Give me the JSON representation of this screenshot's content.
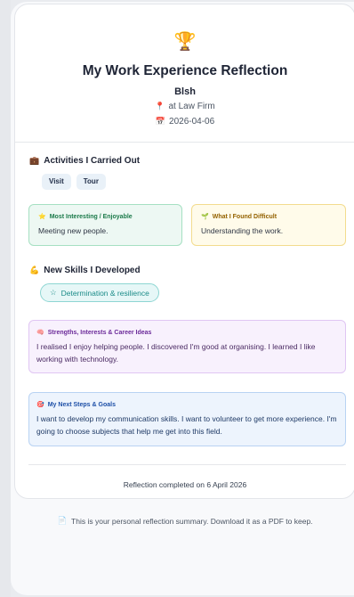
{
  "header": {
    "trophy_icon": "trophy-icon",
    "title": "My Work Experience Reflection",
    "student_name": "Blsh",
    "placement": "at Law Firm",
    "date": "2026-04-06",
    "pin_icon": "pin-icon",
    "calendar_icon": "calendar-icon"
  },
  "activities": {
    "title": "Activities I Carried Out",
    "icon": "briefcase-icon",
    "tags": [
      "Visit",
      "Tour"
    ]
  },
  "interesting": {
    "title": "Most Interesting / Enjoyable",
    "icon": "star-icon",
    "text": "Meeting new people."
  },
  "difficult": {
    "title": "What I Found Difficult",
    "icon": "seedling-icon",
    "text": "Understanding the work."
  },
  "skills": {
    "title": "New Skills I Developed",
    "icon": "flexed-arm-icon",
    "items": [
      "Determination & resilience"
    ]
  },
  "strengths": {
    "title": "Strengths, Interests & Career Ideas",
    "icon": "brain-icon",
    "text": "I realised I enjoy helping people. I discovered I'm good at organising. I learned I like working with technology."
  },
  "next_steps": {
    "title": "My Next Steps & Goals",
    "icon": "target-icon",
    "text": "I want to develop my communication skills. I want to volunteer to get more experience. I'm going to choose subjects that help me get into this field."
  },
  "footer": {
    "completed": "Reflection completed on 6 April 2026",
    "note": "This is your personal reflection summary. Download it as a PDF to keep.",
    "note_icon": "document-icon"
  },
  "colors": {
    "green_accent": "#1b7a4a",
    "yellow_accent": "#946200",
    "teal_accent": "#1b8b88",
    "purple_accent": "#6b2a99",
    "blue_accent": "#1d4fa7"
  }
}
